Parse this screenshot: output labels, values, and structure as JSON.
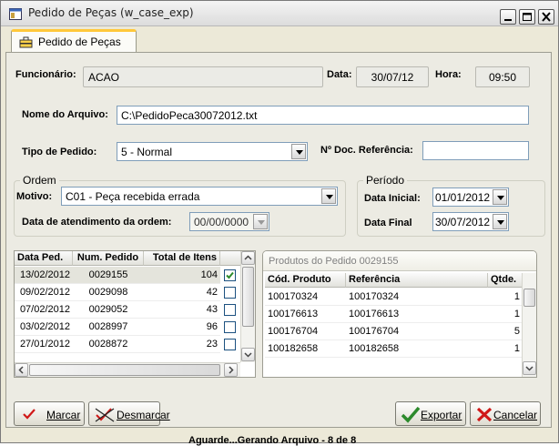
{
  "window": {
    "title": "Pedido de Peças (w_case_exp)"
  },
  "tab": {
    "label": "Pedido de Peças"
  },
  "header": {
    "funcionario_label": "Funcionário:",
    "funcionario_value": "ACAO",
    "data_label": "Data:",
    "data_value": "30/07/12",
    "hora_label": "Hora:",
    "hora_value": "09:50"
  },
  "arquivo": {
    "label": "Nome do Arquivo:",
    "value": "C:\\PedidoPeca30072012.txt"
  },
  "tipo": {
    "label": "Tipo de Pedido:",
    "value": "5 - Normal",
    "ref_label": "Nº Doc. Referência:",
    "ref_value": ""
  },
  "ordem": {
    "title": "Ordem",
    "motivo_label": "Motivo:",
    "motivo_value": "C01 - Peça recebida errada",
    "atend_label": "Data de atendimento da ordem:",
    "atend_value": "00/00/0000"
  },
  "periodo": {
    "title": "Período",
    "inicial_label": "Data Inicial:",
    "inicial_value": "01/01/2012",
    "final_label": "Data Final",
    "final_value": "30/07/2012"
  },
  "pedidos": {
    "headers": [
      "Data Ped.",
      "Num. Pedido",
      "Total de Itens"
    ],
    "rows": [
      {
        "data": "13/02/2012",
        "num": "0029155",
        "total": "104",
        "checked": true
      },
      {
        "data": "09/02/2012",
        "num": "0029098",
        "total": "42",
        "checked": false
      },
      {
        "data": "07/02/2012",
        "num": "0029052",
        "total": "43",
        "checked": false
      },
      {
        "data": "03/02/2012",
        "num": "0028997",
        "total": "96",
        "checked": false
      },
      {
        "data": "27/01/2012",
        "num": "0028872",
        "total": "23",
        "checked": false
      }
    ]
  },
  "produtos": {
    "title": "Produtos do Pedido 0029155",
    "headers": [
      "Cód. Produto",
      "Referência",
      "Qtde."
    ],
    "rows": [
      {
        "cod": "100170324",
        "ref": "100170324",
        "qtde": "1"
      },
      {
        "cod": "100176613",
        "ref": "100176613",
        "qtde": "1"
      },
      {
        "cod": "100176704",
        "ref": "100176704",
        "qtde": "5"
      },
      {
        "cod": "100182658",
        "ref": "100182658",
        "qtde": "1"
      }
    ]
  },
  "status": "Aguarde...Gerando Arquivo - 8 de 8",
  "buttons": {
    "marcar": "Marcar",
    "desmarcar": "Desmarcar",
    "exportar": "Exportar",
    "cancelar": "Cancelar"
  },
  "colors": {
    "tab_accent": "#ffc83a",
    "check_green": "#2c8a2c",
    "cancel_red": "#d01818"
  }
}
